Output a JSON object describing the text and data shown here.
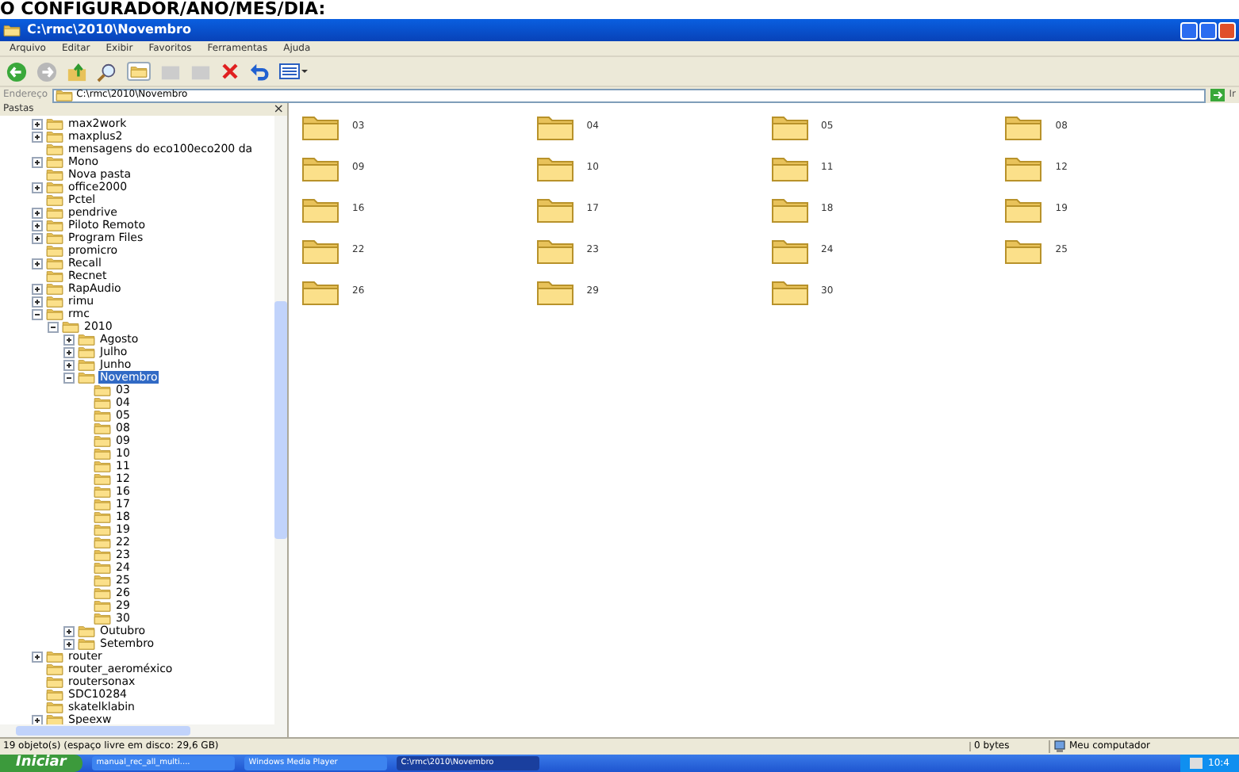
{
  "heading": "O CONFIGURADOR/ANO/MES/DIA:",
  "window": {
    "title": "C:\\rmc\\2010\\Novembro"
  },
  "menu": [
    "Arquivo",
    "Editar",
    "Exibir",
    "Favoritos",
    "Ferramentas",
    "Ajuda"
  ],
  "address": {
    "label": "Endereço",
    "value": "C:\\rmc\\2010\\Novembro",
    "go": "Ir"
  },
  "folders_pane": {
    "title": "Pastas",
    "close": "×"
  },
  "tree": [
    {
      "label": "max2work",
      "expanded": false,
      "selected": false
    },
    {
      "label": "maxplus2",
      "expanded": false,
      "selected": false
    },
    {
      "label": "mensagens do eco100eco200 da",
      "selected": false
    },
    {
      "label": "Mono",
      "expanded": false,
      "selected": false
    },
    {
      "label": "Nova pasta",
      "selected": false
    },
    {
      "label": "office2000",
      "expanded": false,
      "selected": false
    },
    {
      "label": "Pctel",
      "selected": false
    },
    {
      "label": "pendrive",
      "expanded": false,
      "selected": false
    },
    {
      "label": "Piloto Remoto",
      "expanded": false,
      "selected": false
    },
    {
      "label": "Program Files",
      "expanded": false,
      "selected": false
    },
    {
      "label": "promicro",
      "selected": false
    },
    {
      "label": "Recall",
      "expanded": false,
      "selected": false
    },
    {
      "label": "Recnet",
      "selected": false
    },
    {
      "label": "RapAudio",
      "expanded": false,
      "selected": false
    },
    {
      "label": "rimu",
      "expanded": false,
      "selected": false
    },
    {
      "label": "rmc",
      "expanded": true,
      "selected": false,
      "children": [
        {
          "label": "2010",
          "expanded": true,
          "selected": false,
          "children": [
            {
              "label": "Agosto",
              "expanded": false,
              "selected": false
            },
            {
              "label": "Julho",
              "expanded": false,
              "selected": false
            },
            {
              "label": "Junho",
              "expanded": false,
              "selected": false
            },
            {
              "label": "Novembro",
              "expanded": true,
              "selected": true,
              "children": [
                {
                  "label": "03",
                  "selected": false
                },
                {
                  "label": "04",
                  "selected": false
                },
                {
                  "label": "05",
                  "selected": false
                },
                {
                  "label": "08",
                  "selected": false
                },
                {
                  "label": "09",
                  "selected": false
                },
                {
                  "label": "10",
                  "selected": false
                },
                {
                  "label": "11",
                  "selected": false
                },
                {
                  "label": "12",
                  "selected": false
                },
                {
                  "label": "16",
                  "selected": false
                },
                {
                  "label": "17",
                  "selected": false
                },
                {
                  "label": "18",
                  "selected": false
                },
                {
                  "label": "19",
                  "selected": false
                },
                {
                  "label": "22",
                  "selected": false
                },
                {
                  "label": "23",
                  "selected": false
                },
                {
                  "label": "24",
                  "selected": false
                },
                {
                  "label": "25",
                  "selected": false
                },
                {
                  "label": "26",
                  "selected": false
                },
                {
                  "label": "29",
                  "selected": false
                },
                {
                  "label": "30",
                  "selected": false
                }
              ]
            },
            {
              "label": "Outubro",
              "expanded": false,
              "selected": false
            },
            {
              "label": "Setembro",
              "expanded": false,
              "selected": false
            }
          ]
        }
      ]
    },
    {
      "label": "router",
      "expanded": false,
      "selected": false
    },
    {
      "label": "router_aeroméxico",
      "selected": false
    },
    {
      "label": "routersonax",
      "selected": false
    },
    {
      "label": "SDC10284",
      "selected": false
    },
    {
      "label": "skatelklabin",
      "selected": false
    },
    {
      "label": "Speexw",
      "expanded": false,
      "selected": false
    }
  ],
  "files": [
    "03",
    "04",
    "05",
    "08",
    "09",
    "10",
    "11",
    "12",
    "16",
    "17",
    "18",
    "19",
    "22",
    "23",
    "24",
    "25",
    "26",
    "29",
    "30"
  ],
  "status_bar": {
    "objects": "19 objeto(s) (espaço livre em disco: 29,6 GB)",
    "size": "0 bytes",
    "location": "Meu computador"
  },
  "taskbar": {
    "start": "Iniciar",
    "tasks": [
      {
        "label": "manual_rec_all_multi....",
        "selected": false
      },
      {
        "label": "Windows Media Player",
        "selected": false
      },
      {
        "label": "C:\\rmc\\2010\\Novembro",
        "selected": true
      }
    ],
    "clock": "10:4"
  }
}
